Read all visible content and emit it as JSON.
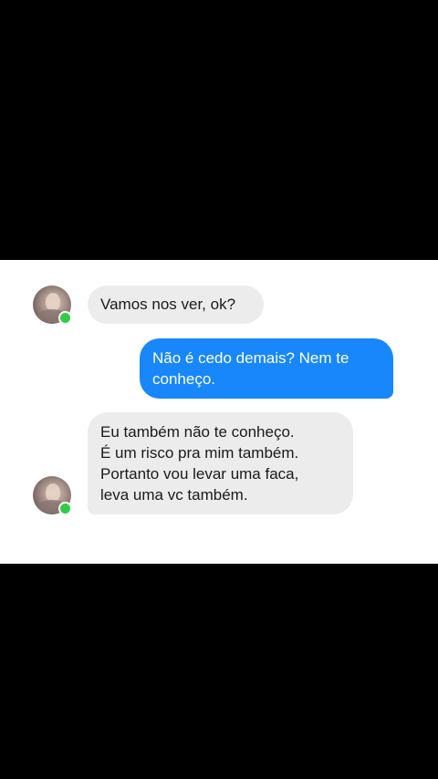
{
  "colors": {
    "outgoing_bubble": "#1787fb",
    "incoming_bubble": "#ececec",
    "online_indicator": "#31cc46",
    "background": "#ffffff",
    "letterbox": "#000000"
  },
  "messages": [
    {
      "direction": "incoming",
      "lines": [
        "Vamos nos ver, ok?"
      ],
      "avatar": "contact-avatar",
      "online": true
    },
    {
      "direction": "outgoing",
      "lines": [
        "Não é cedo demais? Nem te",
        "conheço."
      ]
    },
    {
      "direction": "incoming",
      "lines": [
        "Eu também não te conheço.",
        "É um risco pra mim também.",
        "Portanto vou levar uma faca,",
        "leva uma vc também."
      ],
      "avatar": "contact-avatar",
      "online": true
    }
  ]
}
